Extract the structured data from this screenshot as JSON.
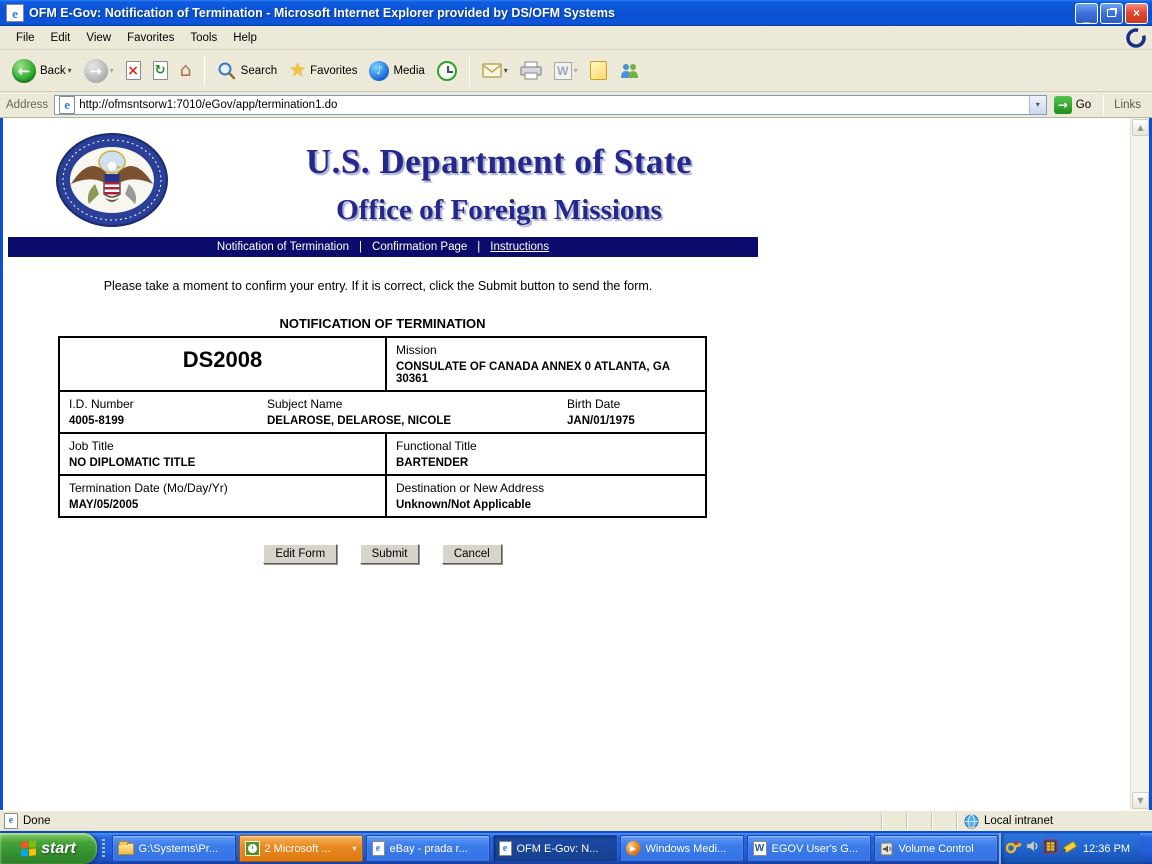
{
  "window": {
    "title": "OFM E-Gov: Notification of Termination - Microsoft Internet Explorer provided by DS/OFM Systems"
  },
  "menu": {
    "items": [
      "File",
      "Edit",
      "View",
      "Favorites",
      "Tools",
      "Help"
    ]
  },
  "toolbar": {
    "back_label": "Back",
    "search_label": "Search",
    "favorites_label": "Favorites",
    "media_label": "Media"
  },
  "address_bar": {
    "label": "Address",
    "url": "http://ofmsntsorw1:7010/eGov/app/termination1.do",
    "go_label": "Go",
    "links_label": "Links"
  },
  "page": {
    "agency_line1": "U.S. Department of State",
    "agency_line2": "Office of Foreign Missions",
    "nav": {
      "separator": "|",
      "items": [
        "Notification of Termination",
        "Confirmation Page",
        "Instructions"
      ]
    },
    "intro": "Please take a moment to confirm your entry. If it is correct, click the Submit button to send the form.",
    "form_title": "NOTIFICATION OF TERMINATION",
    "form": {
      "doc_code": "DS2008",
      "mission_label": "Mission",
      "mission_value": "CONSULATE OF CANADA ANNEX 0 ATLANTA, GA 30361",
      "id_label": "I.D. Number",
      "id_value": "4005-8199",
      "subject_label": "Subject Name",
      "subject_value": "DELAROSE, DELAROSE, NICOLE",
      "birth_label": "Birth Date",
      "birth_value": "JAN/01/1975",
      "job_label": "Job Title",
      "job_value": "NO DIPLOMATIC TITLE",
      "functional_label": "Functional Title",
      "functional_value": "BARTENDER",
      "termination_label": "Termination Date (Mo/Day/Yr)",
      "termination_value": "MAY/05/2005",
      "destination_label": "Destination or New Address",
      "destination_value": "Unknown/Not Applicable"
    },
    "buttons": {
      "edit": "Edit Form",
      "submit": "Submit",
      "cancel": "Cancel"
    }
  },
  "status_bar": {
    "status": "Done",
    "zone": "Local intranet"
  },
  "taskbar": {
    "start_label": "start",
    "items": [
      {
        "label": "G:\\Systems\\Pr...",
        "icon": "folder"
      },
      {
        "label": "2 Microsoft ...",
        "icon": "office-clock",
        "state": "attention"
      },
      {
        "label": "eBay - prada r...",
        "icon": "internet-explorer"
      },
      {
        "label": "OFM E-Gov: N...",
        "icon": "internet-explorer",
        "state": "active"
      },
      {
        "label": "Windows Medi...",
        "icon": "windows-media-player"
      },
      {
        "label": "EGOV User's G...",
        "icon": "word-document"
      },
      {
        "label": "Volume Control",
        "icon": "volume"
      }
    ],
    "tray": {
      "time": "12:36 PM"
    }
  },
  "icons": {
    "back_arrow": "←",
    "forward_arrow": "→",
    "stop_x": "×",
    "refresh": "↻",
    "home": "⌂",
    "favorites_star": "★",
    "media_note": "♪",
    "dropdown": "▾",
    "scroll_up": "▲",
    "scroll_down": "▼",
    "go_arrow": "→",
    "ie_e": "e",
    "word_w": "W",
    "play": "▶",
    "minimize": "_",
    "close_x": "×"
  },
  "colors": {
    "title_navy": "#26278c",
    "nav_band": "#0b0b6b",
    "xp_blue": "#245edc",
    "attention_orange": "#e8871f",
    "start_green": "#379331"
  }
}
